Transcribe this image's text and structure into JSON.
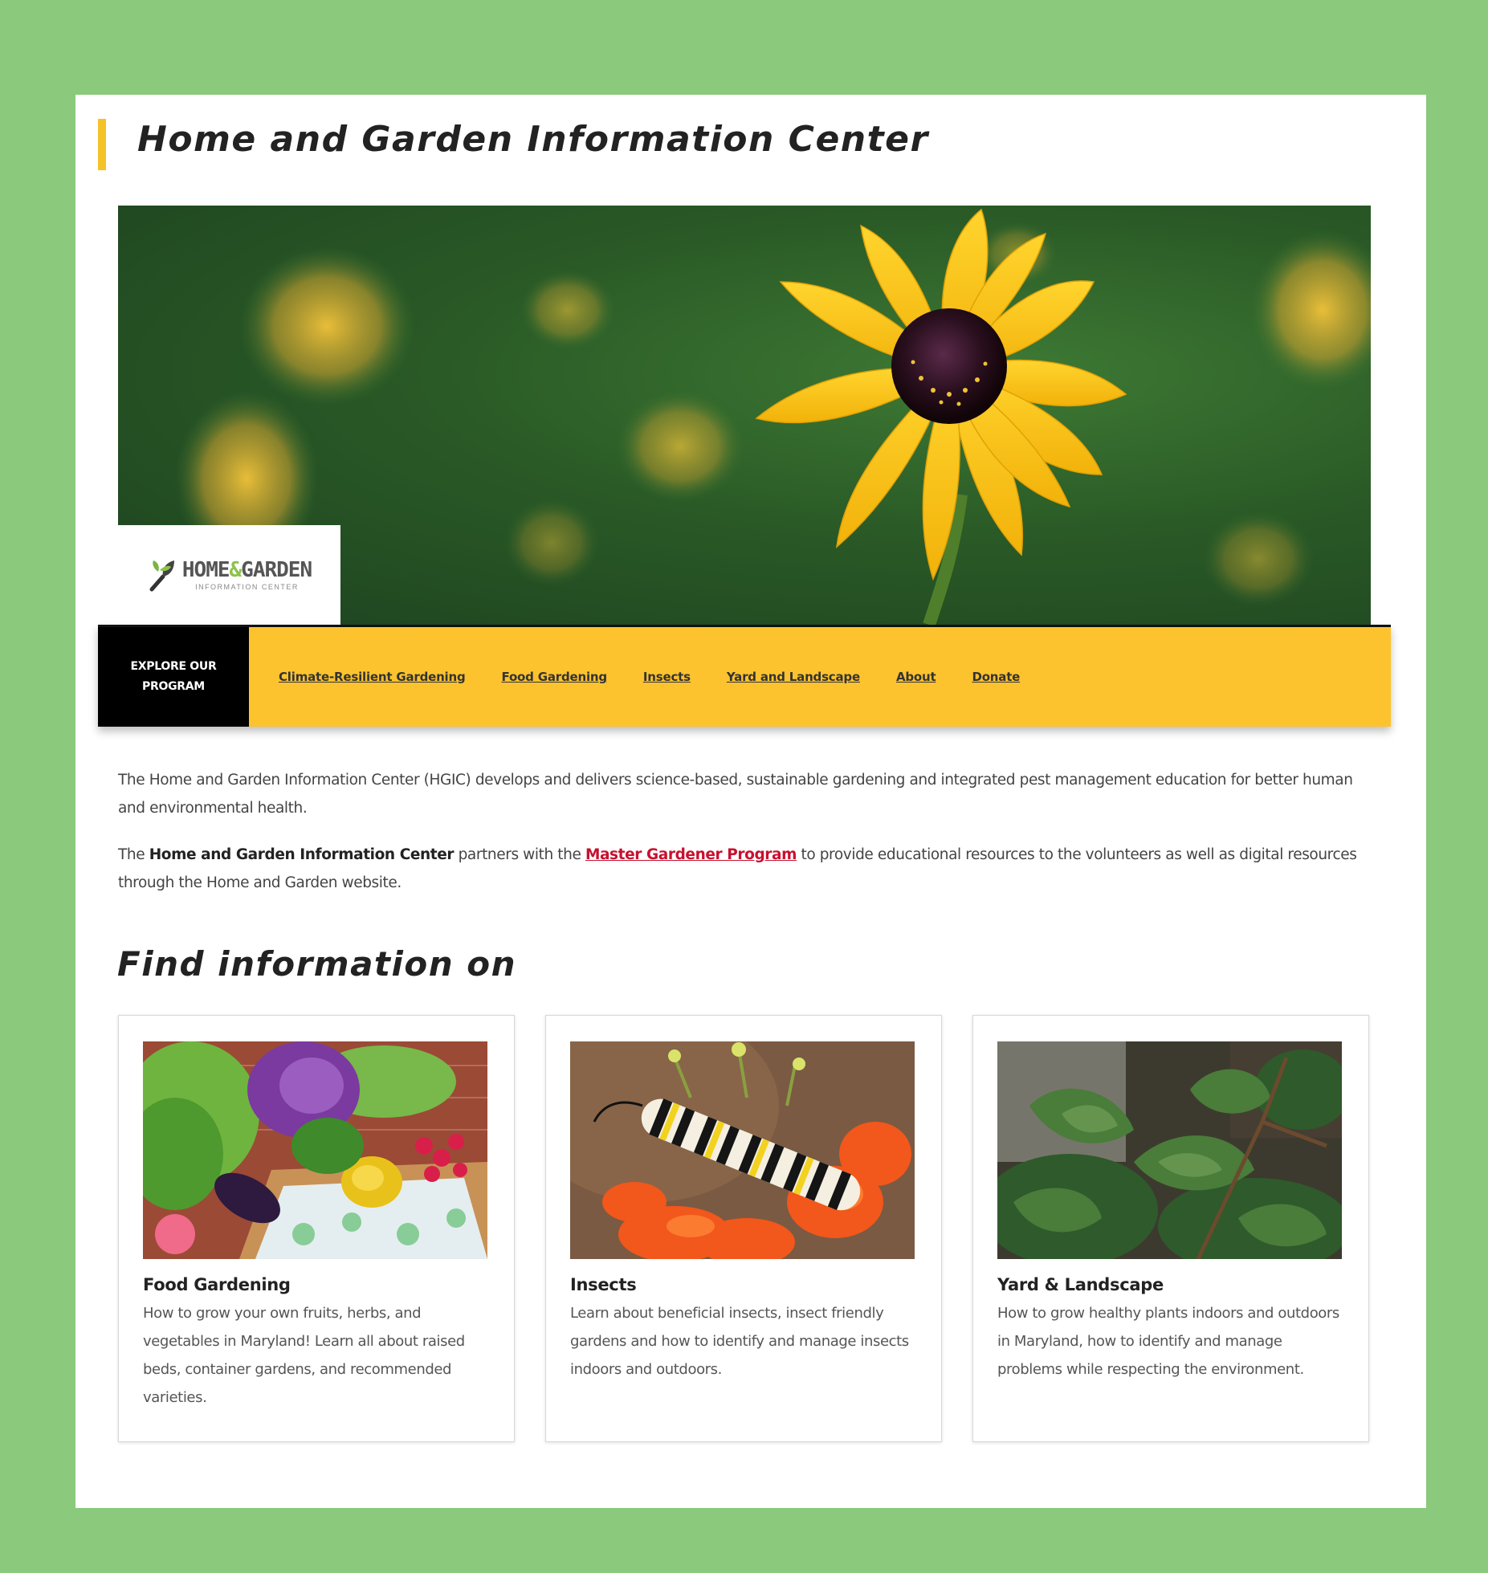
{
  "header": {
    "title": "Home and Garden Information Center"
  },
  "logo": {
    "main_left": "HOME",
    "ampersand": "&",
    "main_right": "GARDEN",
    "sub": "INFORMATION CENTER"
  },
  "nav": {
    "explore_label": "EXPLORE OUR PROGRAM",
    "links": [
      {
        "label": "Climate-Resilient Gardening"
      },
      {
        "label": "Food Gardening"
      },
      {
        "label": "Insects"
      },
      {
        "label": "Yard and Landscape"
      },
      {
        "label": "About"
      },
      {
        "label": "Donate"
      }
    ]
  },
  "intro": {
    "p1": "The Home and Garden Information Center (HGIC) develops and delivers science-based, sustainable gardening and integrated pest management education for better human and environmental health.",
    "p2_start": "The ",
    "p2_bold": "Home and Garden Information Center",
    "p2_mid": " partners with the ",
    "p2_link": "Master Gardener Program",
    "p2_end": " to provide educational resources to the volunteers as well as digital resources through the Home and Garden website."
  },
  "section": {
    "title": "Find information on"
  },
  "cards": [
    {
      "title": "Food Gardening",
      "desc": "How to grow your own fruits, herbs, and vegetables in Maryland! Learn all about raised beds, container gardens, and recommended varieties."
    },
    {
      "title": "Insects",
      "desc": "Learn about beneficial insects, insect friendly gardens and how to identify and manage insects indoors and outdoors."
    },
    {
      "title": "Yard & Landscape",
      "desc": "How to grow healthy plants indoors and outdoors in Maryland, how to identify and manage problems while respecting the environment."
    }
  ],
  "colors": {
    "background": "#8bc97c",
    "accent_yellow": "#fdc32e",
    "title_bar": "#f5c327",
    "link_red": "#c8102e"
  }
}
